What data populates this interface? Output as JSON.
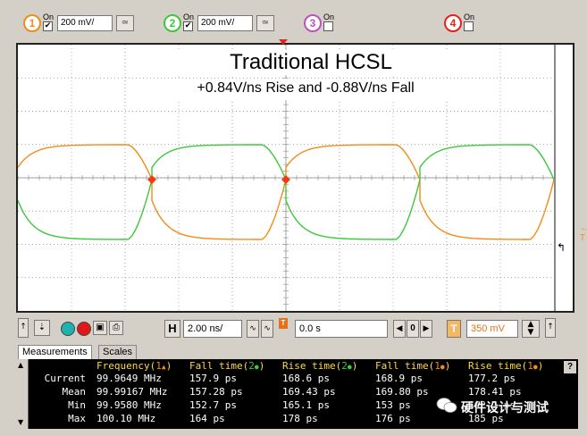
{
  "channels": [
    {
      "num": "1",
      "on_label": "On",
      "checked": true,
      "volts": "200 mV/",
      "coupling": "≃",
      "color": "#f08c18"
    },
    {
      "num": "2",
      "on_label": "On",
      "checked": true,
      "volts": "200 mV/",
      "coupling": "≃",
      "color": "#3cc83c"
    },
    {
      "num": "3",
      "on_label": "On",
      "checked": false,
      "color": "#c050c0"
    },
    {
      "num": "4",
      "on_label": "On",
      "checked": false,
      "color": "#e8201a"
    }
  ],
  "display": {
    "title": "Traditional HCSL",
    "subtitle": "+0.84V/ns Rise and -0.88V/ns Fall",
    "trigger_label": "← T",
    "trace_colors": {
      "ch1": "#f08c18",
      "ch2": "#3cc83c",
      "marker": "#f03c10"
    }
  },
  "controls": {
    "h_label": "H",
    "timebase": "2.00 ns/",
    "delay": "0.0 s",
    "t_label": "T",
    "trigger_level": "350 mV"
  },
  "tabs": [
    "Measurements",
    "Scales"
  ],
  "measurements": {
    "headers": [
      {
        "name": "Frequency(",
        "ch": "1",
        "sym": "▲",
        "end": ")"
      },
      {
        "name": "Fall time(",
        "ch": "2",
        "sym": "●",
        "end": ")"
      },
      {
        "name": "Rise time(",
        "ch": "2",
        "sym": "●",
        "end": ")"
      },
      {
        "name": "Fall time(",
        "ch": "1",
        "sym": "●",
        "end": ")"
      },
      {
        "name": "Rise time(",
        "ch": "1",
        "sym": "●",
        "end": ")"
      }
    ],
    "rows": [
      {
        "label": "Current",
        "values": [
          "99.9649 MHz",
          "157.9 ps",
          "168.6 ps",
          "168.9 ps",
          "177.2 ps"
        ]
      },
      {
        "label": "Mean",
        "values": [
          "99.99167 MHz",
          "157.28 ps",
          "169.43 ps",
          "169.80 ps",
          "178.41 ps"
        ]
      },
      {
        "label": "Min",
        "values": [
          "99.9580 MHz",
          "152.7 ps",
          "165.1 ps",
          "153 ps",
          "162.1 ps"
        ]
      },
      {
        "label": "Max",
        "values": [
          "100.10 MHz",
          "164 ps",
          "178 ps",
          "176 ps",
          "185 ps"
        ]
      }
    ],
    "help": "?"
  },
  "watermark": "硬件设计与测试"
}
